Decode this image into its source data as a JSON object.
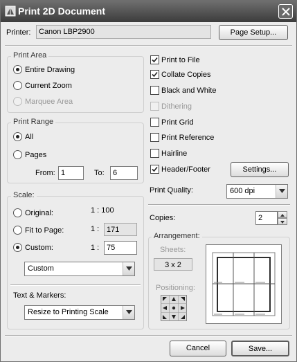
{
  "window": {
    "title": "Print 2D Document"
  },
  "printer": {
    "label": "Printer:",
    "value": "Canon LBP2900",
    "page_setup_label": "Page Setup..."
  },
  "print_area": {
    "title": "Print Area",
    "options": [
      {
        "label": "Entire Drawing",
        "selected": true,
        "enabled": true
      },
      {
        "label": "Current Zoom",
        "selected": false,
        "enabled": true
      },
      {
        "label": "Marquee Area",
        "selected": false,
        "enabled": false
      }
    ]
  },
  "print_range": {
    "title": "Print Range",
    "all_label": "All",
    "pages_label": "Pages",
    "from_label": "From:",
    "from_value": "1",
    "to_label": "To:",
    "to_value": "6"
  },
  "scale": {
    "title": "Scale:",
    "original_label": "Original:",
    "original_value": "1 : 100",
    "fit_label": "Fit to Page:",
    "fit_prefix": "1 :",
    "fit_value": "171",
    "custom_label": "Custom:",
    "custom_prefix": "1 :",
    "custom_value": "75",
    "custom_select": "Custom"
  },
  "text_markers": {
    "label": "Text & Markers:",
    "value": "Resize to Printing Scale"
  },
  "options": [
    {
      "label": "Print to File",
      "checked": true,
      "enabled": true
    },
    {
      "label": "Collate Copies",
      "checked": true,
      "enabled": true
    },
    {
      "label": "Black and White",
      "checked": false,
      "enabled": true
    },
    {
      "label": "Dithering",
      "checked": false,
      "enabled": false
    },
    {
      "label": "Print Grid",
      "checked": false,
      "enabled": true
    },
    {
      "label": "Print Reference",
      "checked": false,
      "enabled": true
    },
    {
      "label": "Hairline",
      "checked": false,
      "enabled": true
    },
    {
      "label": "Header/Footer",
      "checked": true,
      "enabled": true
    }
  ],
  "settings_label": "Settings...",
  "print_quality": {
    "label": "Print Quality:",
    "value": "600 dpi"
  },
  "copies": {
    "label": "Copies:",
    "value": "2"
  },
  "arrangement": {
    "title": "Arrangement:",
    "sheets_label": "Sheets:",
    "sheets_value": "3 x 2",
    "positioning_label": "Positioning:"
  },
  "footer": {
    "cancel_label": "Cancel",
    "save_label": "Save..."
  },
  "colors": {
    "titlebar": "#4a4a4a",
    "dialog_bg": "#ececec"
  }
}
